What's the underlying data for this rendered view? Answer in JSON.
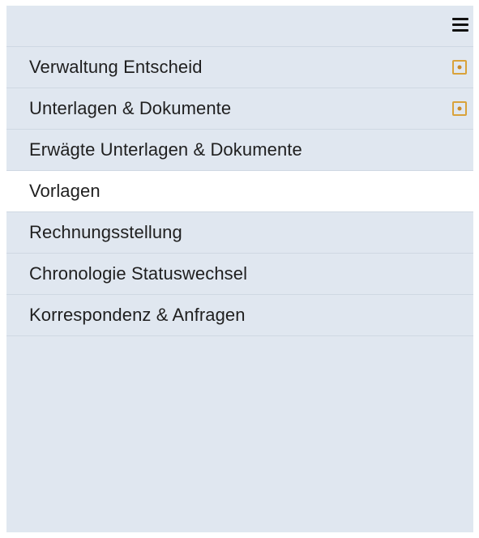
{
  "header": {
    "menu_icon": "hamburger-menu-icon"
  },
  "menu": {
    "items": [
      {
        "label": "Verwaltung Entscheid",
        "badge_icon": "flag-square-icon"
      },
      {
        "label": "Unterlagen & Dokumente",
        "badge_icon": "flag-square-icon"
      },
      {
        "label": "Erwägte Unterlagen & Dokumente"
      },
      {
        "label": "Vorlagen",
        "active": true
      },
      {
        "label": "Rechnungsstellung"
      },
      {
        "label": "Chronologie Statuswechsel"
      },
      {
        "label": "Korrespondenz & Anfragen"
      }
    ]
  },
  "colors": {
    "panel_bg": "#e0e7f0",
    "active_bg": "#ffffff",
    "divider": "#cfd8e3",
    "badge_accent": "#d9a23a",
    "text": "#1f1f1f"
  }
}
